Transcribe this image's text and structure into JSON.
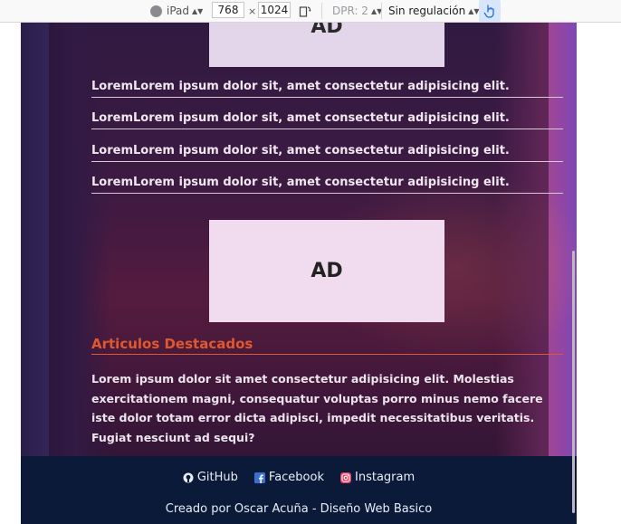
{
  "devtools": {
    "device": "iPad",
    "width": "768",
    "times": "×",
    "height": "1024",
    "dpr": "DPR: 2",
    "throttling": "Sin regulación"
  },
  "page": {
    "top_ad": "AD",
    "list": [
      "LoremLorem ipsum dolor sit, amet consectetur adipisicing elit.",
      "LoremLorem ipsum dolor sit, amet consectetur adipisicing elit.",
      "LoremLorem ipsum dolor sit, amet consectetur adipisicing elit.",
      "LoremLorem ipsum dolor sit, amet consectetur adipisicing elit."
    ],
    "mid_ad": "AD",
    "section_title": "Articulos Destacados",
    "paragraph": "Lorem ipsum dolor sit amet consectetur adipisicing elit. Molestias exercitationem magni, consequatur voluptas porro minus nemo facere iste dolor totam error dicta adipisci, impedit necessitatibus veritatis. Fugiat nesciunt ad sequi?"
  },
  "footer": {
    "links": [
      {
        "label": "GitHub",
        "icon": "github-icon"
      },
      {
        "label": "Facebook",
        "icon": "facebook-icon"
      },
      {
        "label": "Instagram",
        "icon": "instagram-icon"
      }
    ],
    "credits": "Creado por Oscar Acuña - Diseño Web Basico"
  },
  "colors": {
    "accent": "#e0582e",
    "footer_bg": "#0c1a3a",
    "touch_active": "#d8e6fb"
  }
}
